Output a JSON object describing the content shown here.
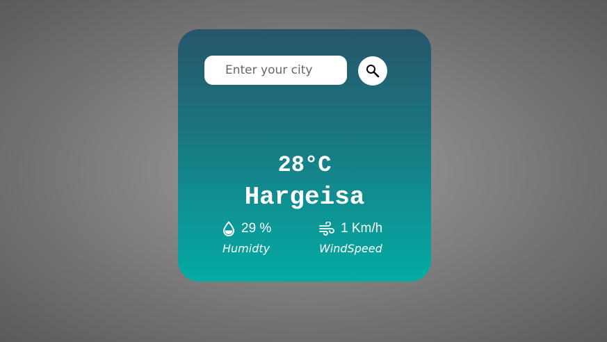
{
  "search": {
    "placeholder": "Enter your city",
    "value": "",
    "icon": "search-icon"
  },
  "weather": {
    "temperature": "28°C",
    "city": "Hargeisa",
    "humidity": {
      "value": "29 %",
      "label": "Humidty",
      "icon": "water-drop-icon"
    },
    "wind": {
      "value": "1 Km/h",
      "label": "WindSpeed",
      "icon": "wind-icon"
    }
  },
  "colors": {
    "card_top": "#26566a",
    "card_bottom": "#04aba3",
    "text": "#ffffff"
  }
}
